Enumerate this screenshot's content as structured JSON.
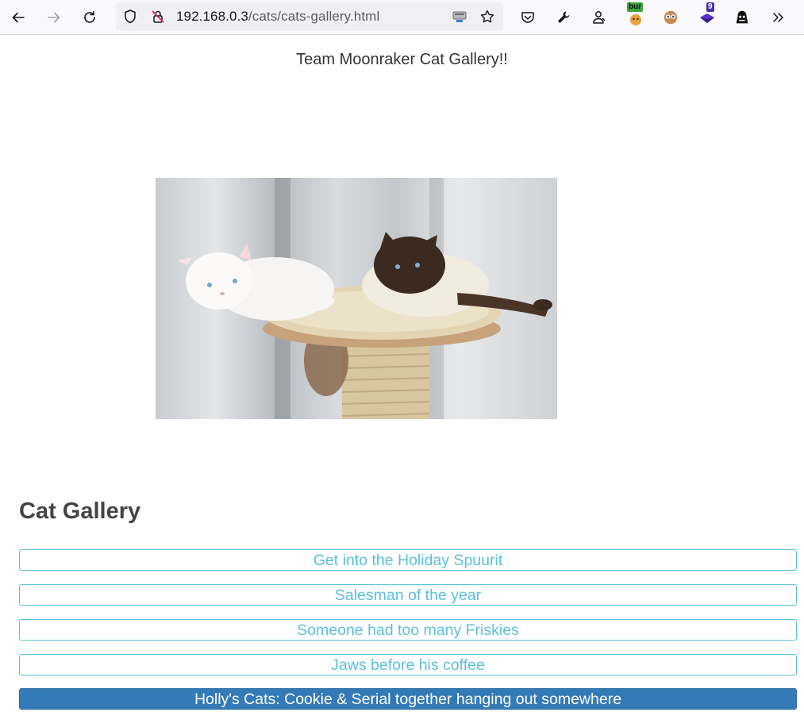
{
  "browser": {
    "url_host": "192.168.0.3",
    "url_path": "/cats/cats-gallery.html",
    "extensions": [
      {
        "name": "burp-extension",
        "badge": "bur",
        "badge_color": "#3fa33f"
      },
      {
        "name": "owl-extension"
      },
      {
        "name": "purple-gem-extension",
        "badge": "9",
        "badge_color": "#4b2fa8"
      },
      {
        "name": "spy-extension"
      }
    ]
  },
  "page": {
    "title": "Team Moonraker Cat Gallery!!",
    "image_alt": "Two cats lounging on a cat tree platform",
    "section_heading": "Cat Gallery"
  },
  "gallery": {
    "items": [
      {
        "label": "Get into the Holiday Spuurit",
        "active": false
      },
      {
        "label": "Salesman of the year",
        "active": false
      },
      {
        "label": "Someone had too many Friskies",
        "active": false
      },
      {
        "label": "Jaws before his coffee",
        "active": false
      },
      {
        "label": "Holly's Cats: Cookie & Serial together hanging out somewhere",
        "active": true
      }
    ]
  },
  "colors": {
    "button_outline": "#5bc0de",
    "button_active_bg": "#337ab7",
    "heading_text": "#444444"
  }
}
